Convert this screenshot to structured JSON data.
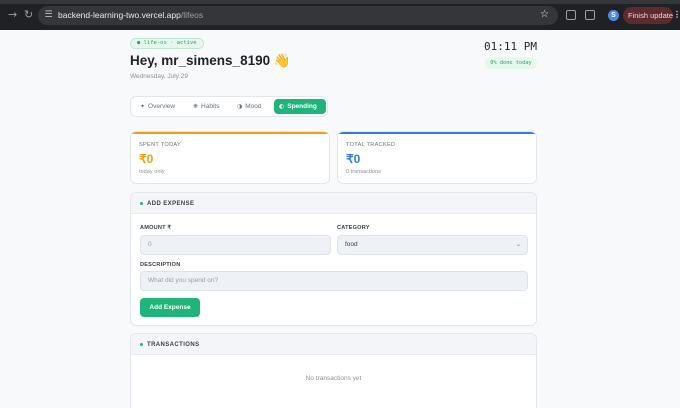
{
  "browser": {
    "url_host": "backend-learning-two.vercel.app",
    "url_path": "/lifeos",
    "profile_initial": "S",
    "finish_update_label": "Finish update"
  },
  "header": {
    "status": "● life-os · active",
    "greeting": "Hey, mr_simens_8190 👋",
    "date": "Wednesday, July 29",
    "clock": "01:11 PM",
    "done_today": "0% done today"
  },
  "tabs": [
    {
      "icon": "✦",
      "label": "Overview",
      "active": false
    },
    {
      "icon": "❋",
      "label": "Habits",
      "active": false
    },
    {
      "icon": "◑",
      "label": "Mood",
      "active": false
    },
    {
      "icon": "◐",
      "label": "Spending",
      "active": true
    }
  ],
  "stats": {
    "spent_today": {
      "label": "SPENT TODAY",
      "value": "₹0",
      "sub": "today only",
      "color": "#f29d11"
    },
    "total_tracked": {
      "label": "TOTAL TRACKED",
      "value": "₹0",
      "sub": "0 transactions",
      "color": "#2f7de1"
    }
  },
  "add_expense": {
    "title": "ADD EXPENSE",
    "amount_label": "AMOUNT ₹",
    "amount_placeholder": "0",
    "category_label": "CATEGORY",
    "category_value": "food",
    "description_label": "DESCRIPTION",
    "description_placeholder": "What did you spend on?",
    "button_label": "Add Expense"
  },
  "transactions": {
    "title": "TRANSACTIONS",
    "empty_text": "No transactions yet"
  },
  "colors": {
    "accent": "#1fb47a",
    "orange": "#f29d11",
    "blue": "#2f7de1"
  }
}
